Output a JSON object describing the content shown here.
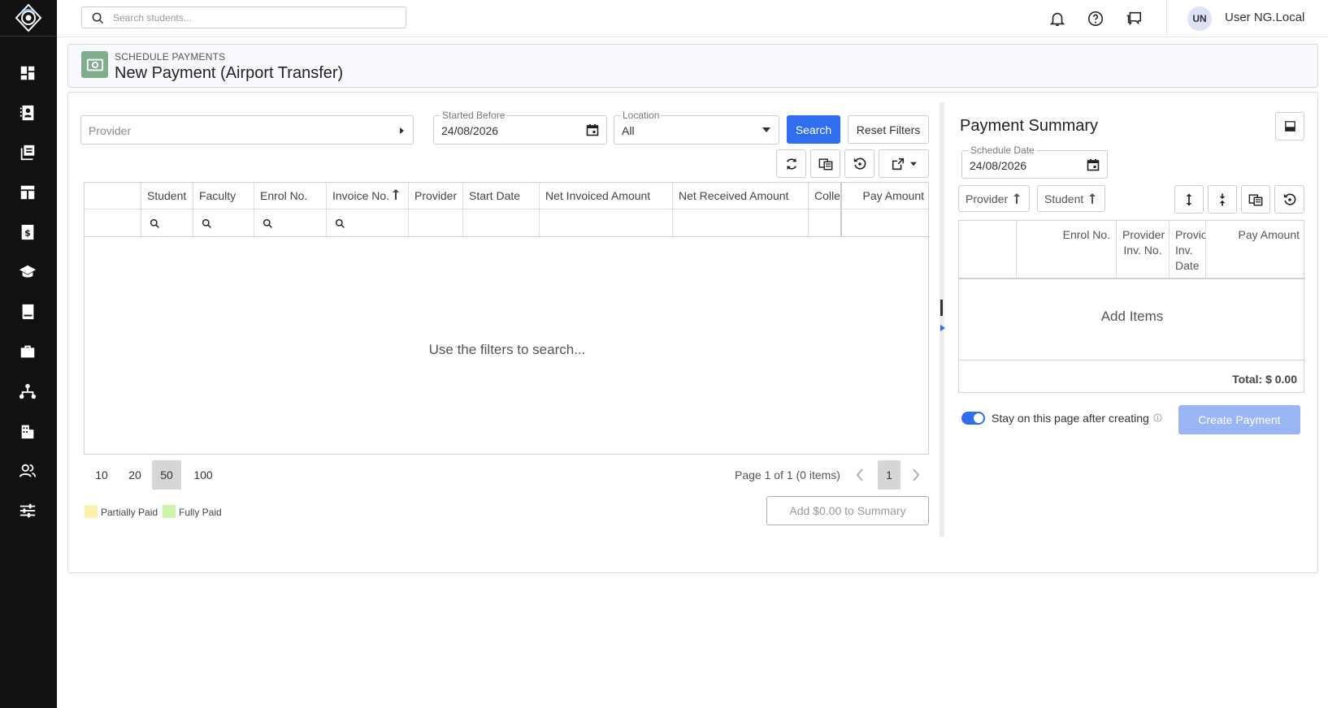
{
  "topbar": {
    "search_placeholder": "Search students...",
    "avatar_initials": "UN",
    "user_name": "User NG.Local"
  },
  "header": {
    "subtitle": "SCHEDULE PAYMENTS",
    "title": "New Payment (Airport Transfer)"
  },
  "filters": {
    "provider_placeholder": "Provider",
    "started_before_label": "Started Before",
    "started_before_value": "24/08/2026",
    "location_label": "Location",
    "location_value": "All",
    "search_button": "Search",
    "reset_button": "Reset Filters"
  },
  "grid": {
    "columns": [
      "Student",
      "Faculty",
      "Enrol No.",
      "Invoice No.",
      "Provider",
      "Start Date",
      "Net Invoiced Amount",
      "Net Received Amount",
      "Colle",
      "Pay Amount"
    ],
    "empty_message": "Use the filters to search...",
    "page_sizes": [
      "10",
      "20",
      "50",
      "100"
    ],
    "selected_page_size": "50",
    "page_info": "Page 1 of 1 (0 items)",
    "current_page": "1",
    "add_button": "Add $0.00 to Summary"
  },
  "legend": {
    "partially_paid": "Partially Paid",
    "fully_paid": "Fully Paid",
    "partially_color": "#fbf1a9",
    "fully_color": "#cdf5a8"
  },
  "summary": {
    "title": "Payment Summary",
    "schedule_date_label": "Schedule Date",
    "schedule_date_value": "24/08/2026",
    "group_provider": "Provider",
    "group_student": "Student",
    "columns": {
      "enrol": "Enrol No.",
      "provider_inv": "Provider Inv. No.",
      "provider_inv_date": "Provic Inv. Date",
      "pay_amount": "Pay Amount"
    },
    "empty_message": "Add Items",
    "total": "Total: $ 0.00",
    "stay_label": "Stay on this page after creating",
    "create_button": "Create Payment"
  },
  "colors": {
    "primary": "#2f6fef",
    "sidebar": "#111111",
    "header_icon": "#7fae8e"
  }
}
